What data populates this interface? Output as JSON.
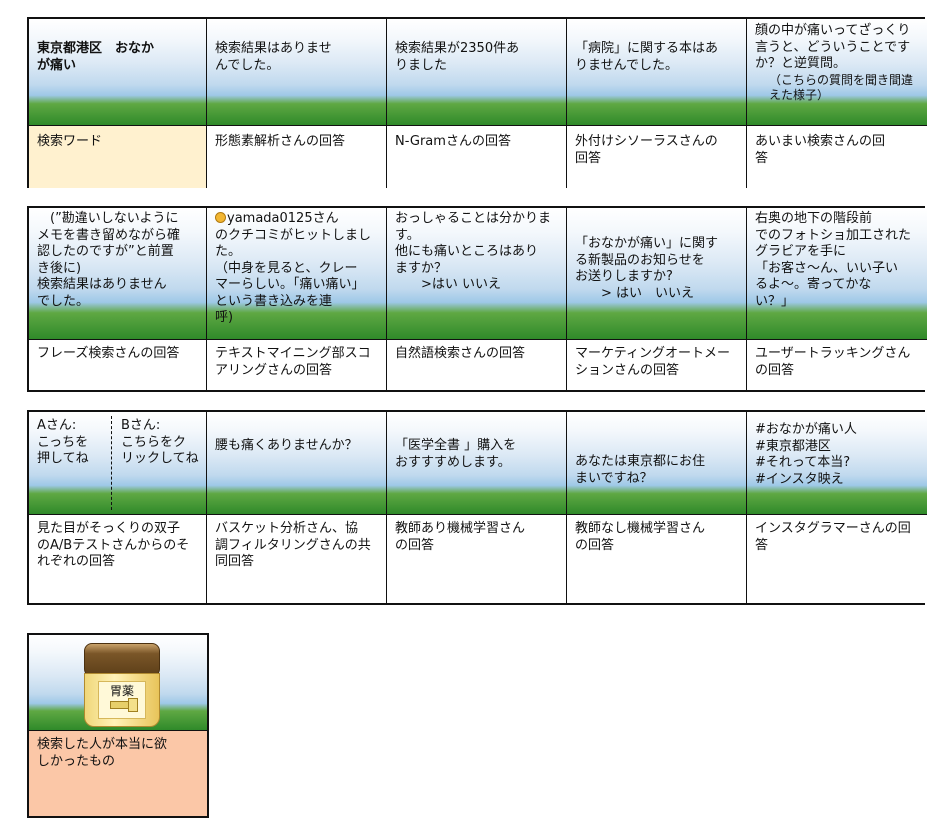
{
  "table1": {
    "top": [
      "東京都港区　おなか\nが痛い",
      "検索結果はありませ\nんでした。",
      "検索結果が2350件あ\nりました",
      "「病院」に関する本はあ\nりませんでした。",
      "顔の中が痛いってざっくり\n言うと、どういうことです\nか？と逆質問。"
    ],
    "top_note": "（こちらの質問を聞き間違\nえた様子）",
    "bottom": [
      "検索ワード",
      "形態素解析さんの回答",
      "N-Gramさんの回答",
      "外付けシソーラスさんの\n回答",
      "あいまい検索さんの回\n答"
    ]
  },
  "table2": {
    "top": [
      "　(”勘違いしないように\nメモを書き留めながら確\n認したのですが”と前置\nき後に)\n検索結果はありません\nでした。",
      "yamada0125さん\nのクチコミがヒットしました。\n（中身を見ると、クレー\nマーらしい。「痛い痛い」\nという書き込みを連\n呼)",
      "おっしゃることは分かりま\nす。\n他にも痛いところはあり\nますか？\n　　>はい いいえ",
      "「おなかが痛い」に関す\nる新製品のお知らせを\nお送りしますか?\n　　> はい　いいえ",
      "右奥の地下の階段前\nでのフォトショ加工された\nグラビアを手に\n「お客さ～ん、いい子い\nるよ～。寄ってかな\nい？」"
    ],
    "bottom": [
      "フレーズ検索さんの回答",
      "テキストマイニング部スコ\nアリングさんの回答",
      "自然語検索さんの回答",
      "マーケティングオートメー\nションさんの回答",
      "ユーザートラッキングさん\nの回答"
    ]
  },
  "table3": {
    "ab_a": "Aさん:\nこっちを\n押してね",
    "ab_b": "Bさん:\nこちらをク\nリックしてね",
    "top": [
      "腰も痛くありませんか？",
      "「医学全書 」購入を\nおすすすめします。",
      "あなたは東京都にお住\nまいですね？",
      "#おなかが痛い人\n#東京都港区\n#それって本当?\n#インスタ映え"
    ],
    "bottom": [
      "見た目がそっくりの双子\nのA/Bテストさんからのそ\nれぞれの回答",
      "バスケット分析さん、協\n調フィルタリングさんの共\n同回答",
      "教師あり機械学習さん\nの回答",
      "教師なし機械学習さん\nの回答",
      "インスタグラマーさんの回\n答"
    ]
  },
  "table4": {
    "jar_label": "胃薬",
    "bottom": "検索した人が本当に欲\nしかったもの"
  }
}
